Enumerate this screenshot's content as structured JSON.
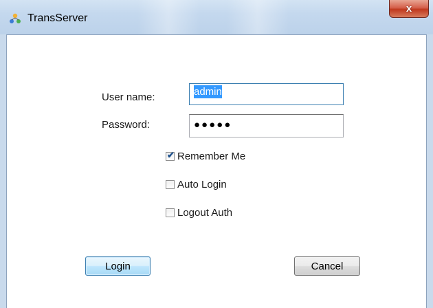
{
  "window": {
    "title": "TransServer",
    "close_glyph": "x",
    "icon": "network-users-icon"
  },
  "form": {
    "username_label": "User name:",
    "username_value": "admin",
    "password_label": "Password:",
    "password_mask": "●●●●●"
  },
  "options": {
    "remember_me": {
      "label": "Remember Me",
      "checked": true
    },
    "auto_login": {
      "label": "Auto Login",
      "checked": false
    },
    "logout_auth": {
      "label": "Logout Auth",
      "checked": false
    }
  },
  "buttons": {
    "login_label": "Login",
    "cancel_label": "Cancel"
  },
  "colors": {
    "titlebar": "#c4d8ee",
    "close_button": "#c0391f",
    "selection": "#3399ff",
    "focus_border": "#3c7fb1"
  }
}
